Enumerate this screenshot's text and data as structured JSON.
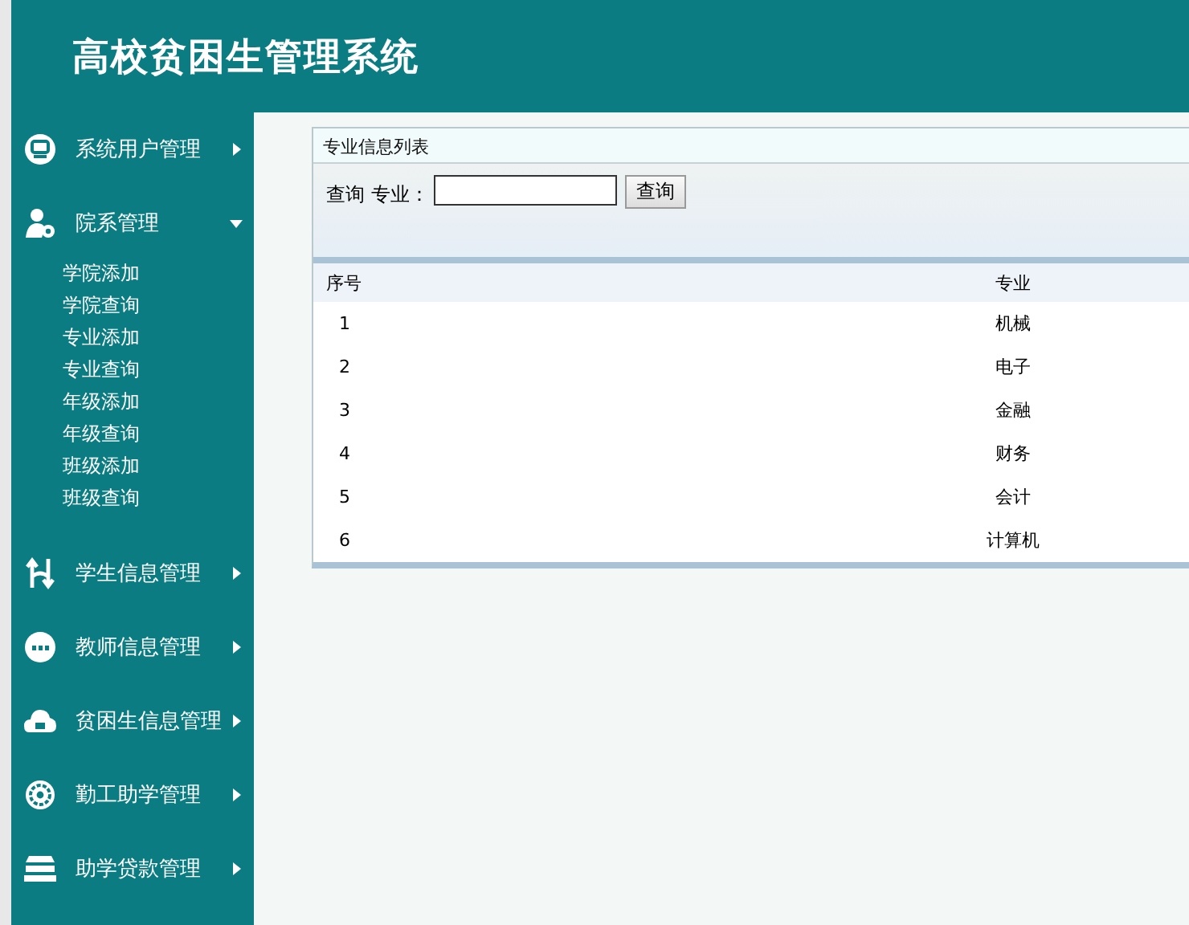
{
  "header": {
    "title": "高校贫困生管理系统"
  },
  "sidebar": {
    "items": [
      {
        "label": "系统用户管理",
        "expanded": false
      },
      {
        "label": "院系管理",
        "expanded": true,
        "children": [
          {
            "label": "学院添加"
          },
          {
            "label": "学院查询"
          },
          {
            "label": "专业添加"
          },
          {
            "label": "专业查询"
          },
          {
            "label": "年级添加"
          },
          {
            "label": "年级查询"
          },
          {
            "label": "班级添加"
          },
          {
            "label": "班级查询"
          }
        ]
      },
      {
        "label": "学生信息管理",
        "expanded": false
      },
      {
        "label": "教师信息管理",
        "expanded": false
      },
      {
        "label": "贫困生信息管理",
        "expanded": false
      },
      {
        "label": "勤工助学管理",
        "expanded": false
      },
      {
        "label": "助学贷款管理",
        "expanded": false
      }
    ]
  },
  "panel": {
    "title": "专业信息列表",
    "search": {
      "label": "查询 专业：",
      "button": "查询"
    },
    "table": {
      "columns": [
        "序号",
        "专业"
      ],
      "rows": [
        [
          "1",
          "机械"
        ],
        [
          "2",
          "电子"
        ],
        [
          "3",
          "金融"
        ],
        [
          "4",
          "财务"
        ],
        [
          "5",
          "会计"
        ],
        [
          "6",
          "计算机"
        ]
      ]
    }
  }
}
